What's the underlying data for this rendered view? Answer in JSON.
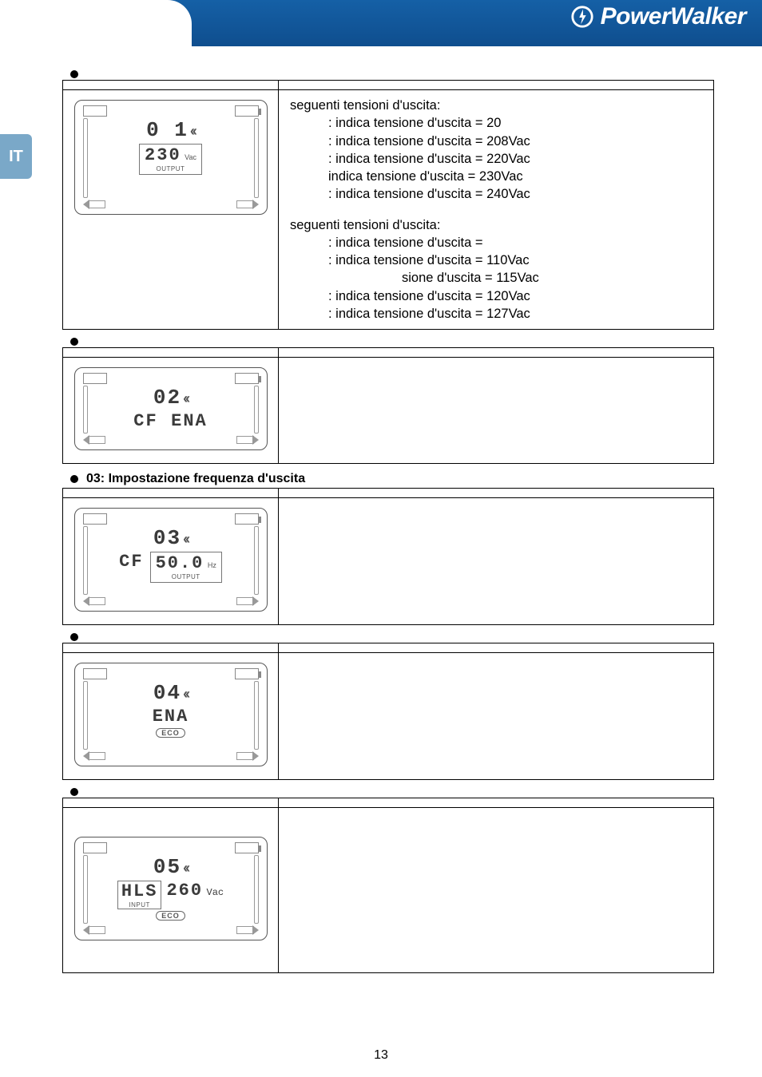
{
  "brand": "PowerWalker",
  "side_tab": "IT",
  "page_number": "13",
  "sections": [
    {
      "heading": "",
      "lcd": {
        "top": "0 1",
        "line2_left": "",
        "line2_right_val": "230",
        "line2_right_unit": "Vac",
        "line2_right_sublabel": "OUTPUT"
      },
      "desc_lines": [
        {
          "t": "seguenti tensioni d'uscita:",
          "cls": ""
        },
        {
          "t": ": indica tensione d'uscita = 20",
          "cls": "indent1"
        },
        {
          "t": ": indica tensione d'uscita = 208Vac",
          "cls": "indent1"
        },
        {
          "t": ": indica tensione d'uscita = 220Vac",
          "cls": "indent1"
        },
        {
          "t": "  indica tensione d'uscita = 230Vac",
          "cls": "indent1"
        },
        {
          "t": ": indica tensione d'uscita = 240Vac",
          "cls": "indent1"
        },
        {
          "t": "",
          "cls": ""
        },
        {
          "t": "seguenti tensioni d'uscita:",
          "cls": ""
        },
        {
          "t": ": indica tensione d'uscita =",
          "cls": "indent1"
        },
        {
          "t": ": indica tensione d'uscita = 110Vac",
          "cls": "indent1"
        },
        {
          "t": "sione d'uscita = 115Vac",
          "cls": "indent2"
        },
        {
          "t": ": indica tensione d'uscita = 120Vac",
          "cls": "indent1"
        },
        {
          "t": ": indica tensione d'uscita = 127Vac",
          "cls": "indent1"
        }
      ]
    },
    {
      "heading": "",
      "lcd": {
        "top": "02",
        "line2_left": "CF",
        "line2_right_val": "ENA"
      },
      "desc_lines": []
    },
    {
      "heading": "03: Impostazione frequenza d'uscita",
      "lcd": {
        "top": "03",
        "line2_left": "CF",
        "line2_right_val": "50.0",
        "line2_right_unit": "Hz",
        "line2_right_sublabel": "OUTPUT"
      },
      "desc_lines": []
    },
    {
      "heading": "",
      "lcd": {
        "top": "04",
        "line2_left": "",
        "line2_right_val": "ENA",
        "eco": true
      },
      "desc_lines": []
    },
    {
      "heading": "",
      "lcd": {
        "top": "05",
        "line2_left": "HLS",
        "line2_left_sublabel": "INPUT",
        "line2_right_val": "260",
        "line2_right_unit": "Vac",
        "eco": true
      },
      "desc_lines": []
    }
  ]
}
